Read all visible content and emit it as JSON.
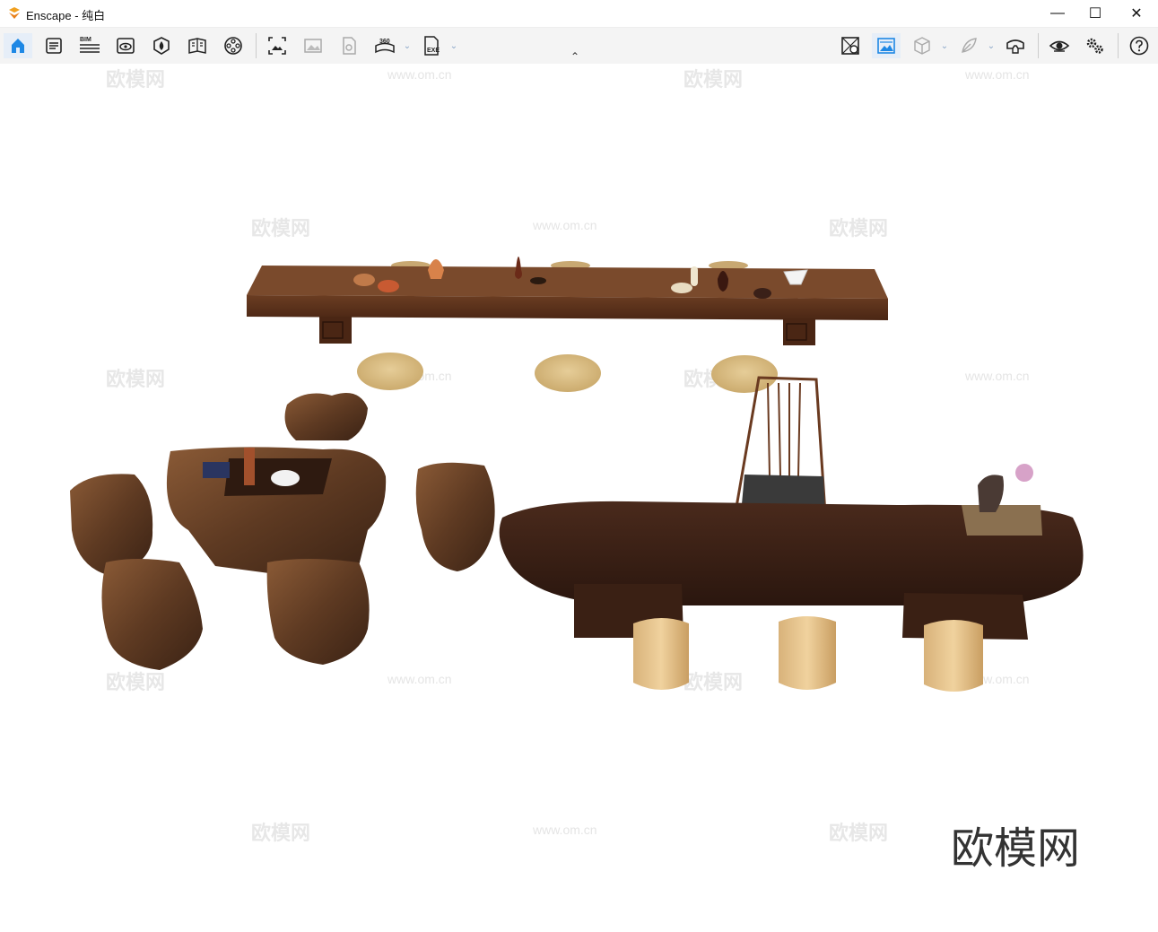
{
  "window": {
    "title": "Enscape - 纯白",
    "minimize_glyph": "—",
    "maximize_glyph": "☐",
    "close_glyph": "✕"
  },
  "toolbar": {
    "left_icons": [
      "home-icon",
      "notes-icon",
      "bim-icon",
      "view-icon",
      "asset-icon",
      "library-icon",
      "reel-icon"
    ],
    "export_icons": [
      "screenshot-icon",
      "batch-render-icon",
      "video-icon",
      "pano-360-icon",
      "exe-export-icon"
    ],
    "right_icons": [
      "material-editor-icon",
      "atmosphere-icon",
      "cube-view-icon",
      "feather-icon",
      "vr-headset-icon",
      "visibility-icon",
      "settings-icon",
      "help-icon"
    ],
    "bim_label": "BIM",
    "pano_label": "360",
    "exe_label": "EXE",
    "collapse_glyph": "⌃",
    "accent": "#1e88e5"
  },
  "watermarks": {
    "logo": "欧模网",
    "url": "www.om.cn",
    "brand": "欧模网"
  }
}
